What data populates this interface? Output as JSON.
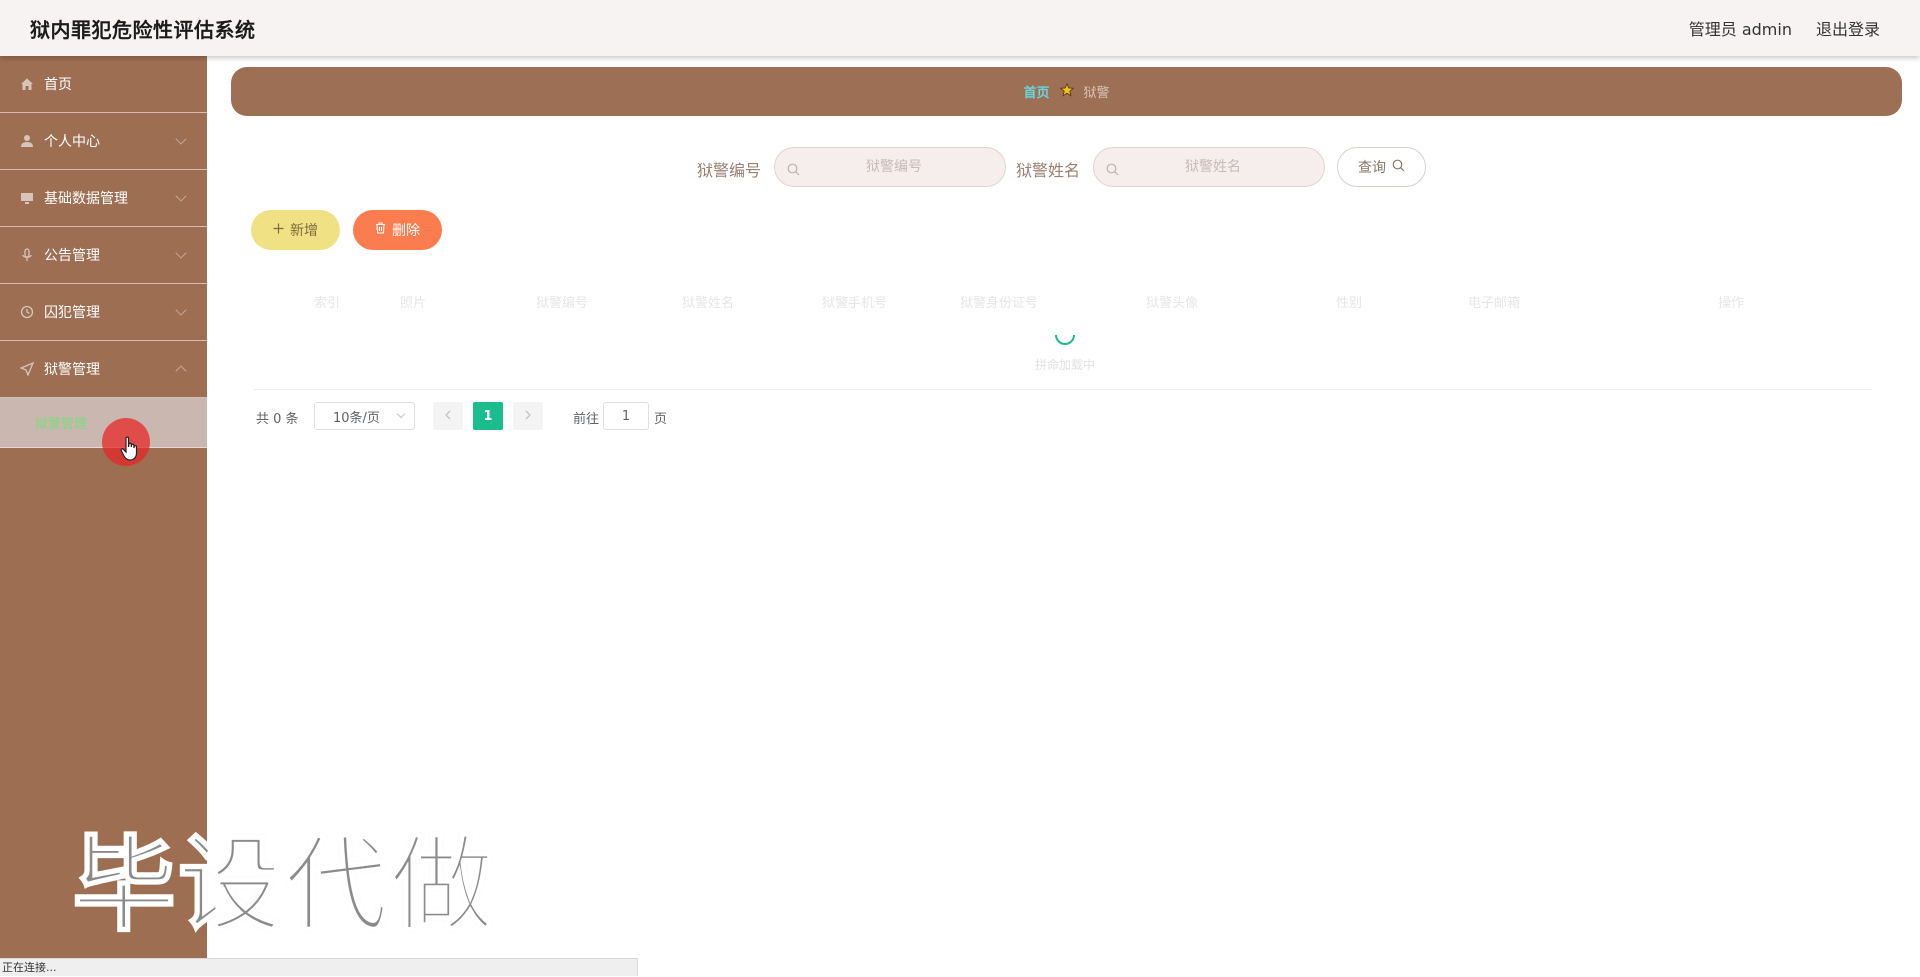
{
  "header": {
    "app_title": "狱内罪犯危险性评估系统",
    "user_label": "管理员 admin",
    "logout_label": "退出登录"
  },
  "sidebar": {
    "items": [
      {
        "label": "首页",
        "icon": "home-icon"
      },
      {
        "label": "个人中心",
        "icon": "user-icon"
      },
      {
        "label": "基础数据管理",
        "icon": "monitor-icon"
      },
      {
        "label": "公告管理",
        "icon": "microphone-icon"
      },
      {
        "label": "囚犯管理",
        "icon": "clock-icon"
      },
      {
        "label": "狱警管理",
        "icon": "location-arrow-icon"
      }
    ],
    "active_submenu": "狱警管理"
  },
  "breadcrumb": {
    "home": "首页",
    "current": "狱警",
    "separator_icon": "star-icon"
  },
  "search": {
    "field1_label": "狱警编号",
    "field1_placeholder": "狱警编号",
    "field2_label": "狱警姓名",
    "field2_placeholder": "狱警姓名",
    "query_label": "查询"
  },
  "actions": {
    "add_label": "新增",
    "delete_label": "删除"
  },
  "table": {
    "columns": [
      "索引",
      "照片",
      "狱警编号",
      "狱警姓名",
      "狱警手机号",
      "狱警身份证号",
      "狱警头像",
      "性别",
      "电子邮箱",
      "操作"
    ],
    "loading_text": "拼命加载中"
  },
  "pagination": {
    "total_text": "共 0 条",
    "page_size": "10条/页",
    "current_page": "1",
    "goto_label": "前往",
    "goto_value": "1",
    "page_unit": "页"
  },
  "watermark": "毕设代做",
  "status_bar": "正在连接...",
  "colors": {
    "sidebar_bg": "#9d6e52",
    "breadcrumb_bg": "#9d7056",
    "add_button": "#f1e185",
    "delete_button": "#fb7c4f",
    "pager_active": "#1bbc8d"
  }
}
